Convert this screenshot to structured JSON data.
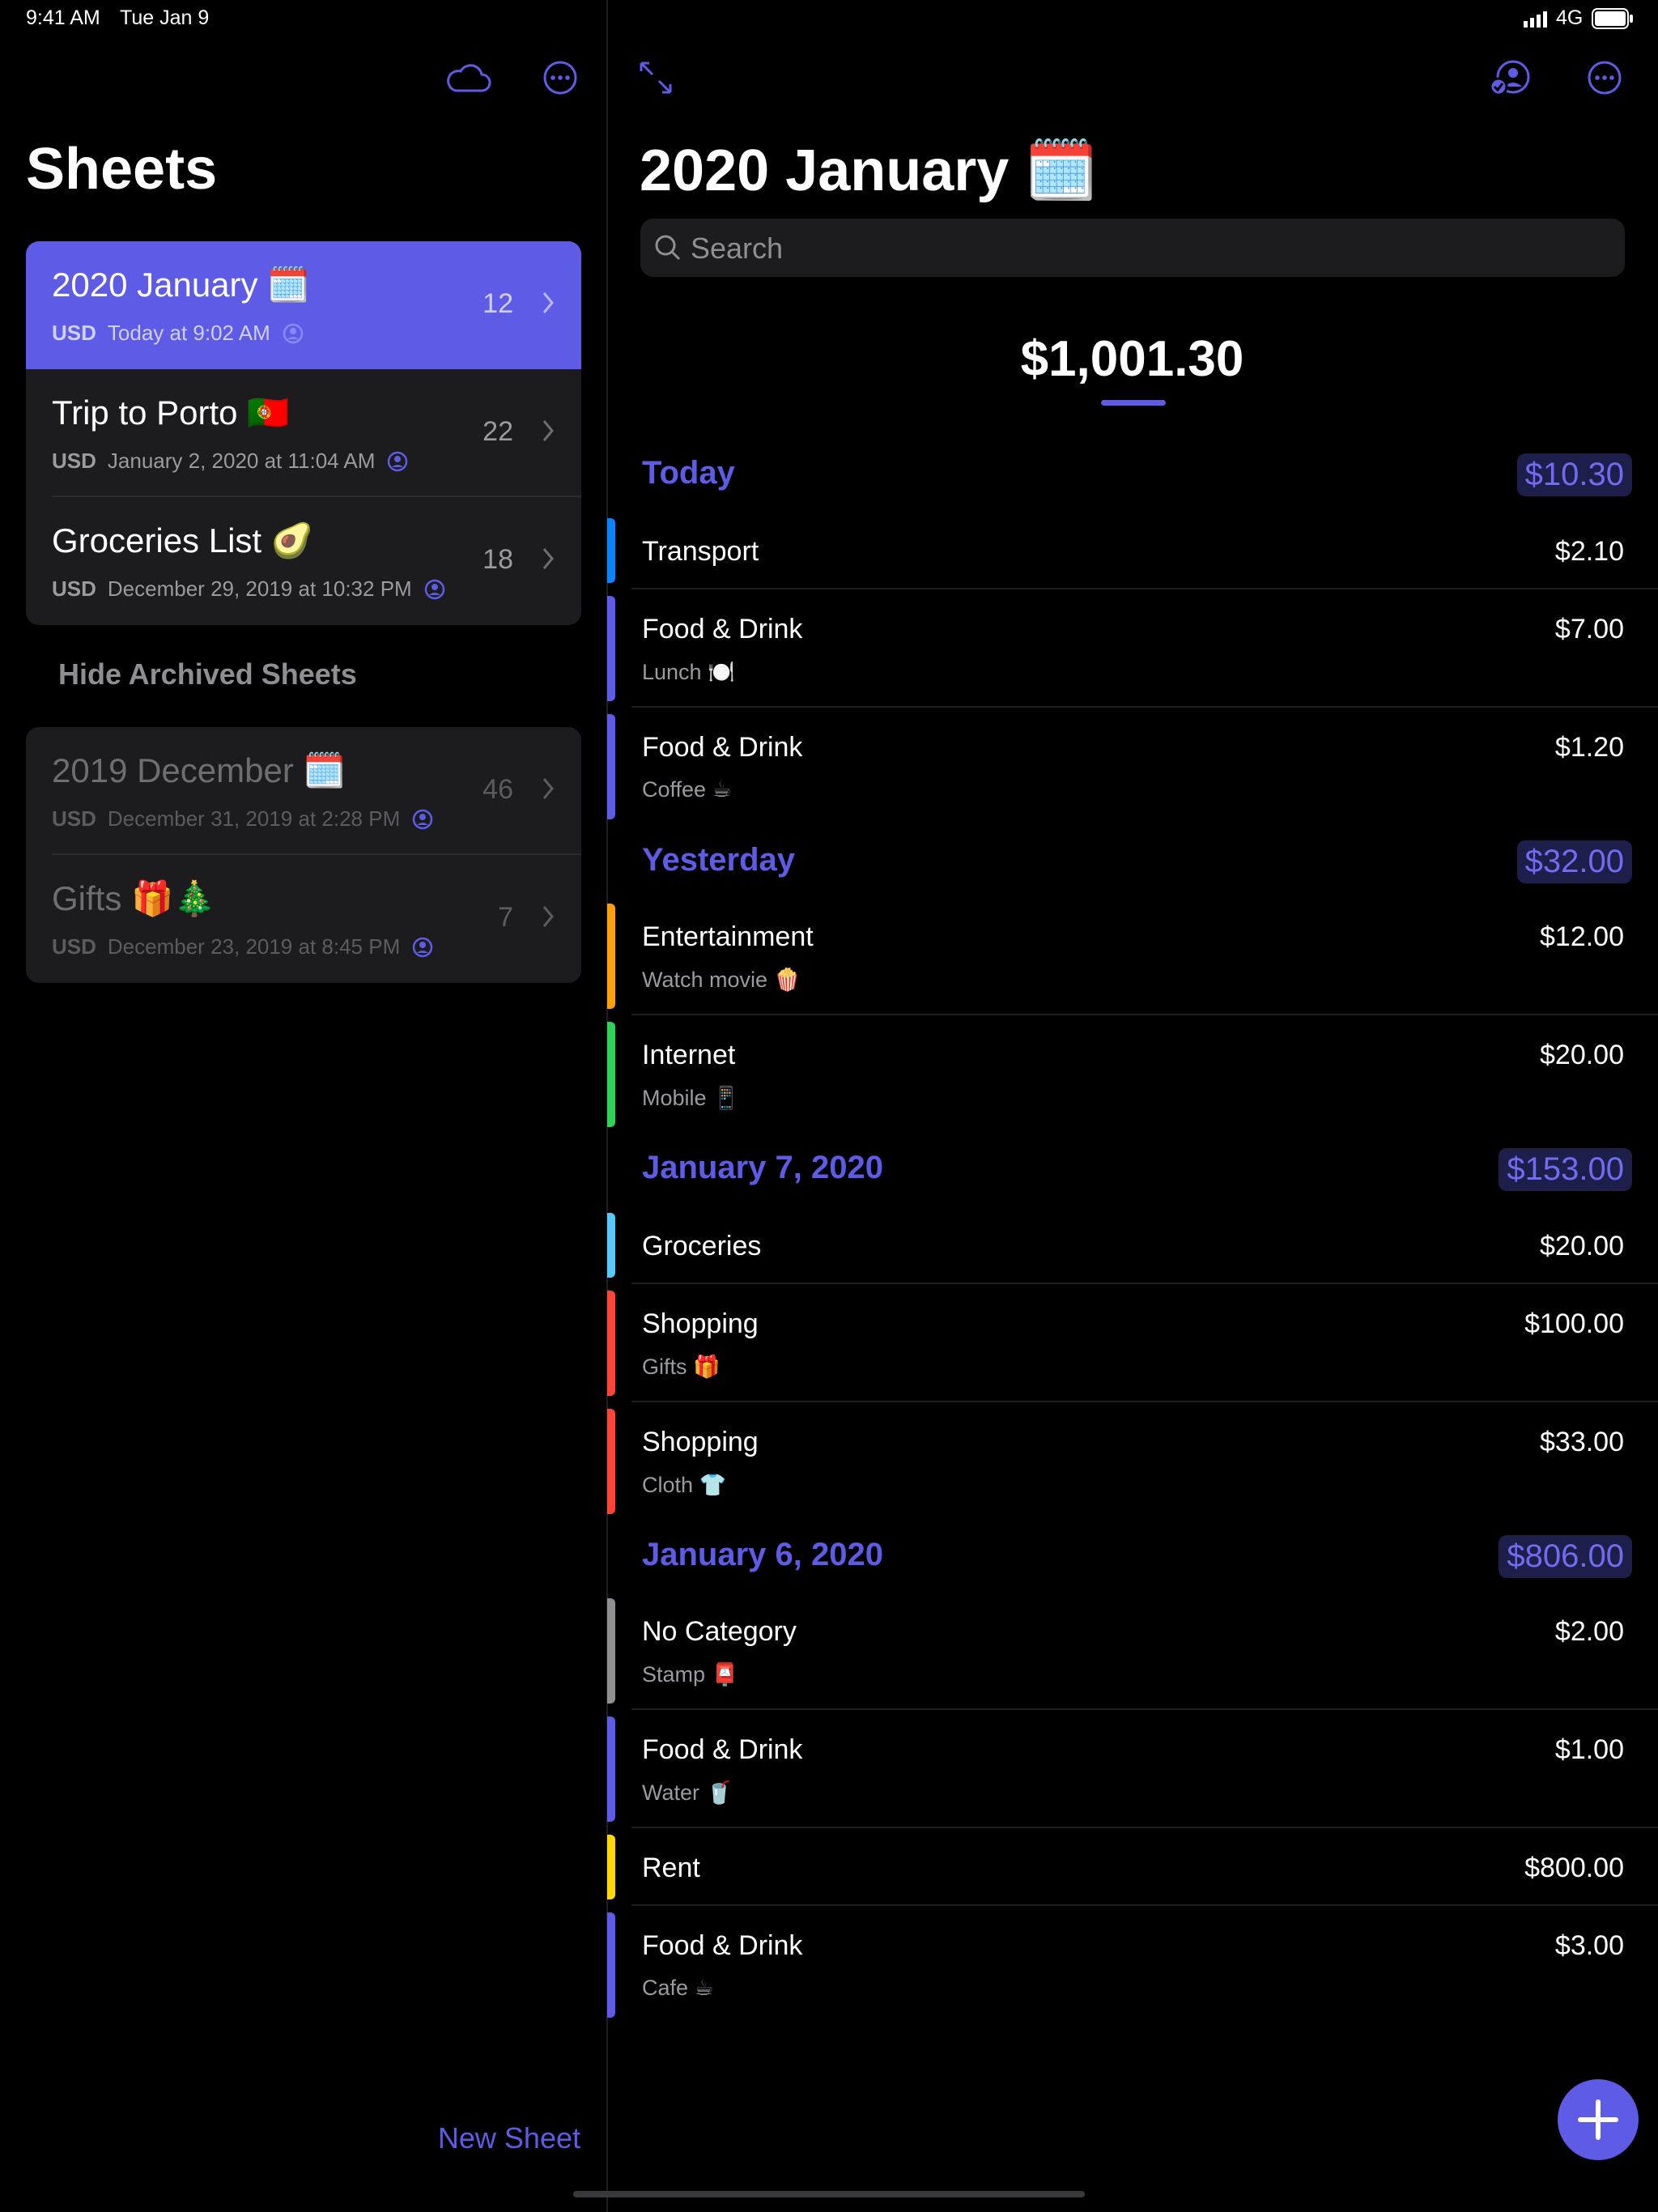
{
  "status_bar": {
    "time": "9:41 AM",
    "date": "Tue Jan 9",
    "network": "4G"
  },
  "sidebar": {
    "title": "Sheets",
    "sheets": [
      {
        "title": "2020 January 🗓️",
        "currency": "USD",
        "date": "Today at 9:02 AM",
        "count": "12",
        "selected": true
      },
      {
        "title": "Trip to Porto 🇵🇹",
        "currency": "USD",
        "date": "January 2, 2020 at 11:04 AM",
        "count": "22"
      },
      {
        "title": "Groceries List 🥑",
        "currency": "USD",
        "date": "December 29, 2019 at 10:32 PM",
        "count": "18"
      }
    ],
    "hide_archived_label": "Hide Archived Sheets",
    "archived": [
      {
        "title": "2019 December 🗓️",
        "currency": "USD",
        "date": "December 31, 2019 at 2:28 PM",
        "count": "46"
      },
      {
        "title": "Gifts 🎁🎄",
        "currency": "USD",
        "date": "December 23, 2019 at 8:45 PM",
        "count": "7"
      }
    ],
    "new_sheet_label": "New Sheet"
  },
  "main": {
    "title": "2020 January 🗓️",
    "search_placeholder": "Search",
    "total": "$1,001.30",
    "sections": [
      {
        "title": "Today",
        "total": "$10.30",
        "items": [
          {
            "category": "Transport",
            "note": "",
            "amount": "$2.10",
            "color": "#0a84ff"
          },
          {
            "category": "Food & Drink",
            "note": "Lunch 🍽️",
            "amount": "$7.00",
            "color": "#5e5ce6"
          },
          {
            "category": "Food & Drink",
            "note": "Coffee ☕",
            "amount": "$1.20",
            "color": "#5e5ce6"
          }
        ]
      },
      {
        "title": "Yesterday",
        "total": "$32.00",
        "items": [
          {
            "category": "Entertainment",
            "note": "Watch movie 🍿",
            "amount": "$12.00",
            "color": "#ff9f0a"
          },
          {
            "category": "Internet",
            "note": "Mobile 📱",
            "amount": "$20.00",
            "color": "#30d158"
          }
        ]
      },
      {
        "title": "January 7, 2020",
        "total": "$153.00",
        "items": [
          {
            "category": "Groceries",
            "note": "",
            "amount": "$20.00",
            "color": "#5ac8fa"
          },
          {
            "category": "Shopping",
            "note": "Gifts 🎁",
            "amount": "$100.00",
            "color": "#ff453a"
          },
          {
            "category": "Shopping",
            "note": "Cloth 👕",
            "amount": "$33.00",
            "color": "#ff453a"
          }
        ]
      },
      {
        "title": "January 6, 2020",
        "total": "$806.00",
        "items": [
          {
            "category": "No Category",
            "note": "Stamp 📮",
            "amount": "$2.00",
            "color": "#8e8e93"
          },
          {
            "category": "Food & Drink",
            "note": "Water 🥤",
            "amount": "$1.00",
            "color": "#5e5ce6"
          },
          {
            "category": "Rent",
            "note": "",
            "amount": "$800.00",
            "color": "#ffd60a"
          },
          {
            "category": "Food & Drink",
            "note": "Cafe ☕",
            "amount": "$3.00",
            "color": "#5e5ce6"
          }
        ]
      }
    ]
  },
  "icons": {
    "cloud": "cloud-icon",
    "more": "ellipsis-circle-icon",
    "expand": "expand-arrows-icon",
    "share": "person-circle-check-icon",
    "search": "magnifier-icon",
    "add": "plus-icon",
    "chevron": "chevron-right-icon",
    "shared": "person-circle-icon"
  },
  "colors": {
    "accent": "#5e5ce6",
    "background": "#000000",
    "card": "#1c1c1e"
  }
}
